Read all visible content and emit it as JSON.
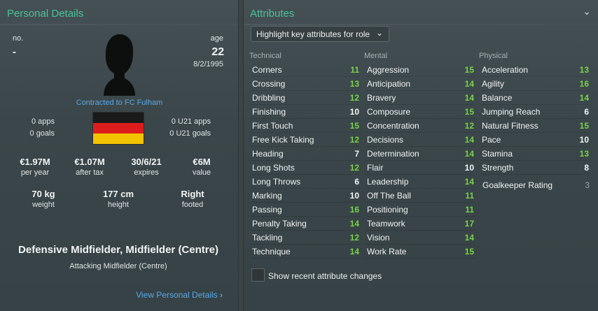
{
  "personal": {
    "title": "Personal Details",
    "no_label": "no.",
    "no_value": "-",
    "age_label": "age",
    "age_value": "22",
    "dob": "8/2/1995",
    "contract": "Contracted to FC Fulham",
    "apps": "0 apps",
    "goals": "0 goals",
    "u21_apps": "0 U21 apps",
    "u21_goals": "0 U21 goals",
    "stats": [
      {
        "value": "€1.97M",
        "label": "per year"
      },
      {
        "value": "€1.07M",
        "label": "after tax"
      },
      {
        "value": "30/6/21",
        "label": "expires"
      },
      {
        "value": "€6M",
        "label": "value"
      }
    ],
    "physical": [
      {
        "value": "70 kg",
        "label": "weight"
      },
      {
        "value": "177 cm",
        "label": "height"
      },
      {
        "value": "Right",
        "label": "footed"
      }
    ],
    "position_main": "Defensive Midfielder, Midfielder (Centre)",
    "position_alt": "Attacking Midfielder (Centre)",
    "view_link": "View Personal Details",
    "flag_colors": [
      "#1a1a1a",
      "#dd1d1d",
      "#f2c300"
    ]
  },
  "attributes": {
    "title": "Attributes",
    "dropdown_label": "Highlight key attributes for role",
    "checkbox_label": "Show recent attribute changes",
    "technical_label": "Technical",
    "mental_label": "Mental",
    "physical_label": "Physical",
    "technical": [
      {
        "name": "Corners",
        "value": "11"
      },
      {
        "name": "Crossing",
        "value": "13"
      },
      {
        "name": "Dribbling",
        "value": "12"
      },
      {
        "name": "Finishing",
        "value": "10"
      },
      {
        "name": "First Touch",
        "value": "15"
      },
      {
        "name": "Free Kick Taking",
        "value": "12"
      },
      {
        "name": "Heading",
        "value": "7"
      },
      {
        "name": "Long Shots",
        "value": "12"
      },
      {
        "name": "Long Throws",
        "value": "6"
      },
      {
        "name": "Marking",
        "value": "10"
      },
      {
        "name": "Passing",
        "value": "16"
      },
      {
        "name": "Penalty Taking",
        "value": "14"
      },
      {
        "name": "Tackling",
        "value": "12"
      },
      {
        "name": "Technique",
        "value": "14"
      }
    ],
    "mental": [
      {
        "name": "Aggression",
        "value": "15"
      },
      {
        "name": "Anticipation",
        "value": "14"
      },
      {
        "name": "Bravery",
        "value": "14"
      },
      {
        "name": "Composure",
        "value": "15"
      },
      {
        "name": "Concentration",
        "value": "12"
      },
      {
        "name": "Decisions",
        "value": "14"
      },
      {
        "name": "Determination",
        "value": "14"
      },
      {
        "name": "Flair",
        "value": "10"
      },
      {
        "name": "Leadership",
        "value": "14"
      },
      {
        "name": "Off The Ball",
        "value": "11"
      },
      {
        "name": "Positioning",
        "value": "11"
      },
      {
        "name": "Teamwork",
        "value": "17"
      },
      {
        "name": "Vision",
        "value": "14"
      },
      {
        "name": "Work Rate",
        "value": "15"
      }
    ],
    "physical": [
      {
        "name": "Acceleration",
        "value": "13"
      },
      {
        "name": "Agility",
        "value": "16"
      },
      {
        "name": "Balance",
        "value": "14"
      },
      {
        "name": "Jumping Reach",
        "value": "6"
      },
      {
        "name": "Natural Fitness",
        "value": "15"
      },
      {
        "name": "Pace",
        "value": "10"
      },
      {
        "name": "Stamina",
        "value": "13"
      },
      {
        "name": "Strength",
        "value": "8"
      }
    ],
    "goalkeeper_label": "Goalkeeper Rating",
    "goalkeeper_value": "3"
  }
}
